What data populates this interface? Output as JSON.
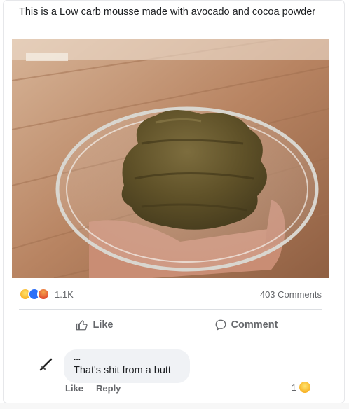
{
  "post": {
    "text": "This is a Low carb mousse made with avocado and cocoa powder",
    "reaction_count": "1.1K",
    "comments_count": "403 Comments"
  },
  "actions": {
    "like_label": "Like",
    "comment_label": "Comment"
  },
  "comment": {
    "author": "...",
    "text": "That's shit from a butt",
    "like_label": "Like",
    "reply_label": "Reply",
    "reaction_count": "1"
  },
  "icons": {
    "reactions": [
      "haha-icon",
      "wow-icon",
      "angry-icon"
    ],
    "like": "thumbs-up-icon",
    "comment": "speech-bubble-icon"
  },
  "colors": {
    "text": "#1c1e21",
    "muted": "#65676b",
    "bubble": "#f0f2f5",
    "divider": "#dcdfe3"
  }
}
